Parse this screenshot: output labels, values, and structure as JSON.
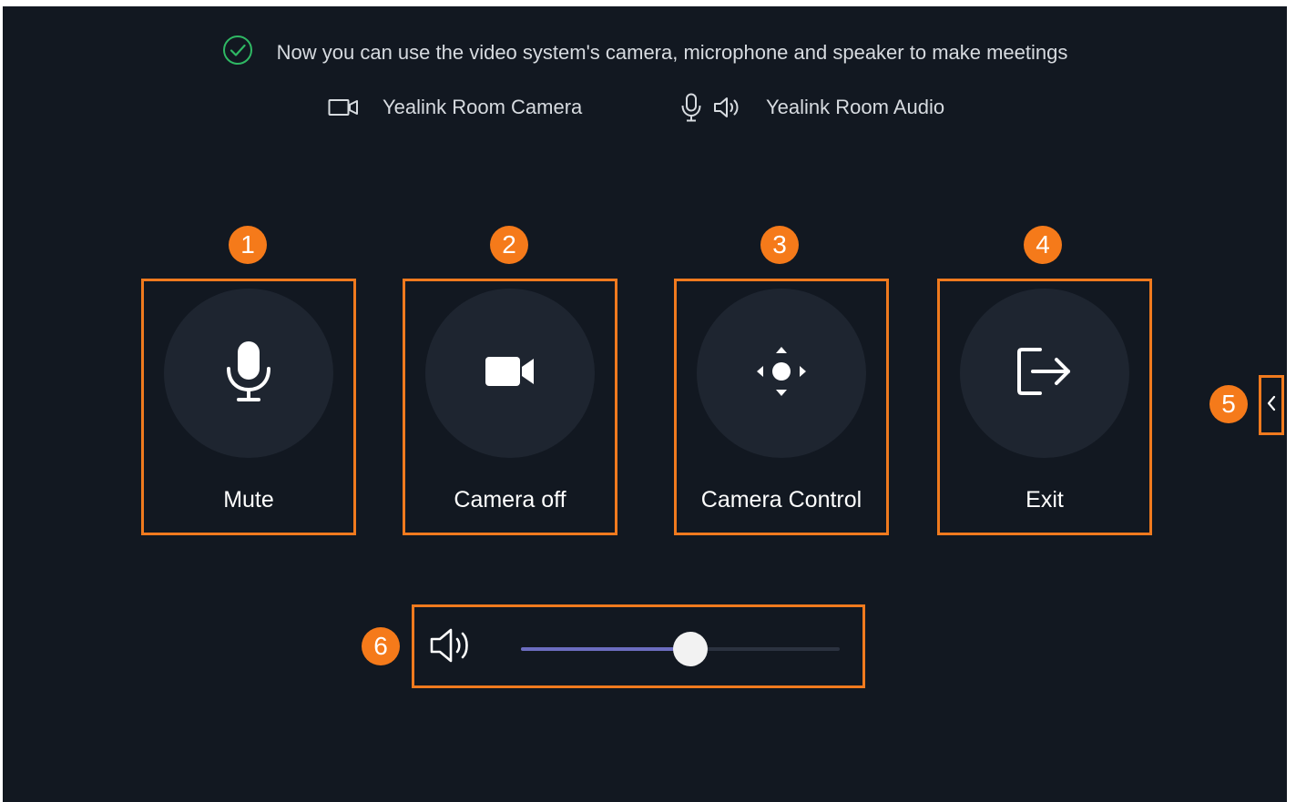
{
  "status": {
    "message": "Now you can use the video system's camera, microphone and speaker to make meetings"
  },
  "devices": {
    "camera": "Yealink Room Camera",
    "audio": "Yealink Room Audio"
  },
  "controls": [
    {
      "badge": "1",
      "label": "Mute",
      "icon": "microphone-icon"
    },
    {
      "badge": "2",
      "label": "Camera off",
      "icon": "video-camera-icon"
    },
    {
      "badge": "3",
      "label": "Camera Control",
      "icon": "move-arrows-icon"
    },
    {
      "badge": "4",
      "label": "Exit",
      "icon": "exit-icon"
    }
  ],
  "side_tab": {
    "badge": "5",
    "icon": "chevron-left-icon"
  },
  "volume": {
    "badge": "6",
    "icon": "speaker-icon",
    "level_fraction": 0.53
  },
  "colors": {
    "background": "#121821",
    "highlight_border": "#f07a1e",
    "badge": "#f57a1a",
    "success": "#2fb864",
    "slider_fill": "#6c6dc0"
  }
}
